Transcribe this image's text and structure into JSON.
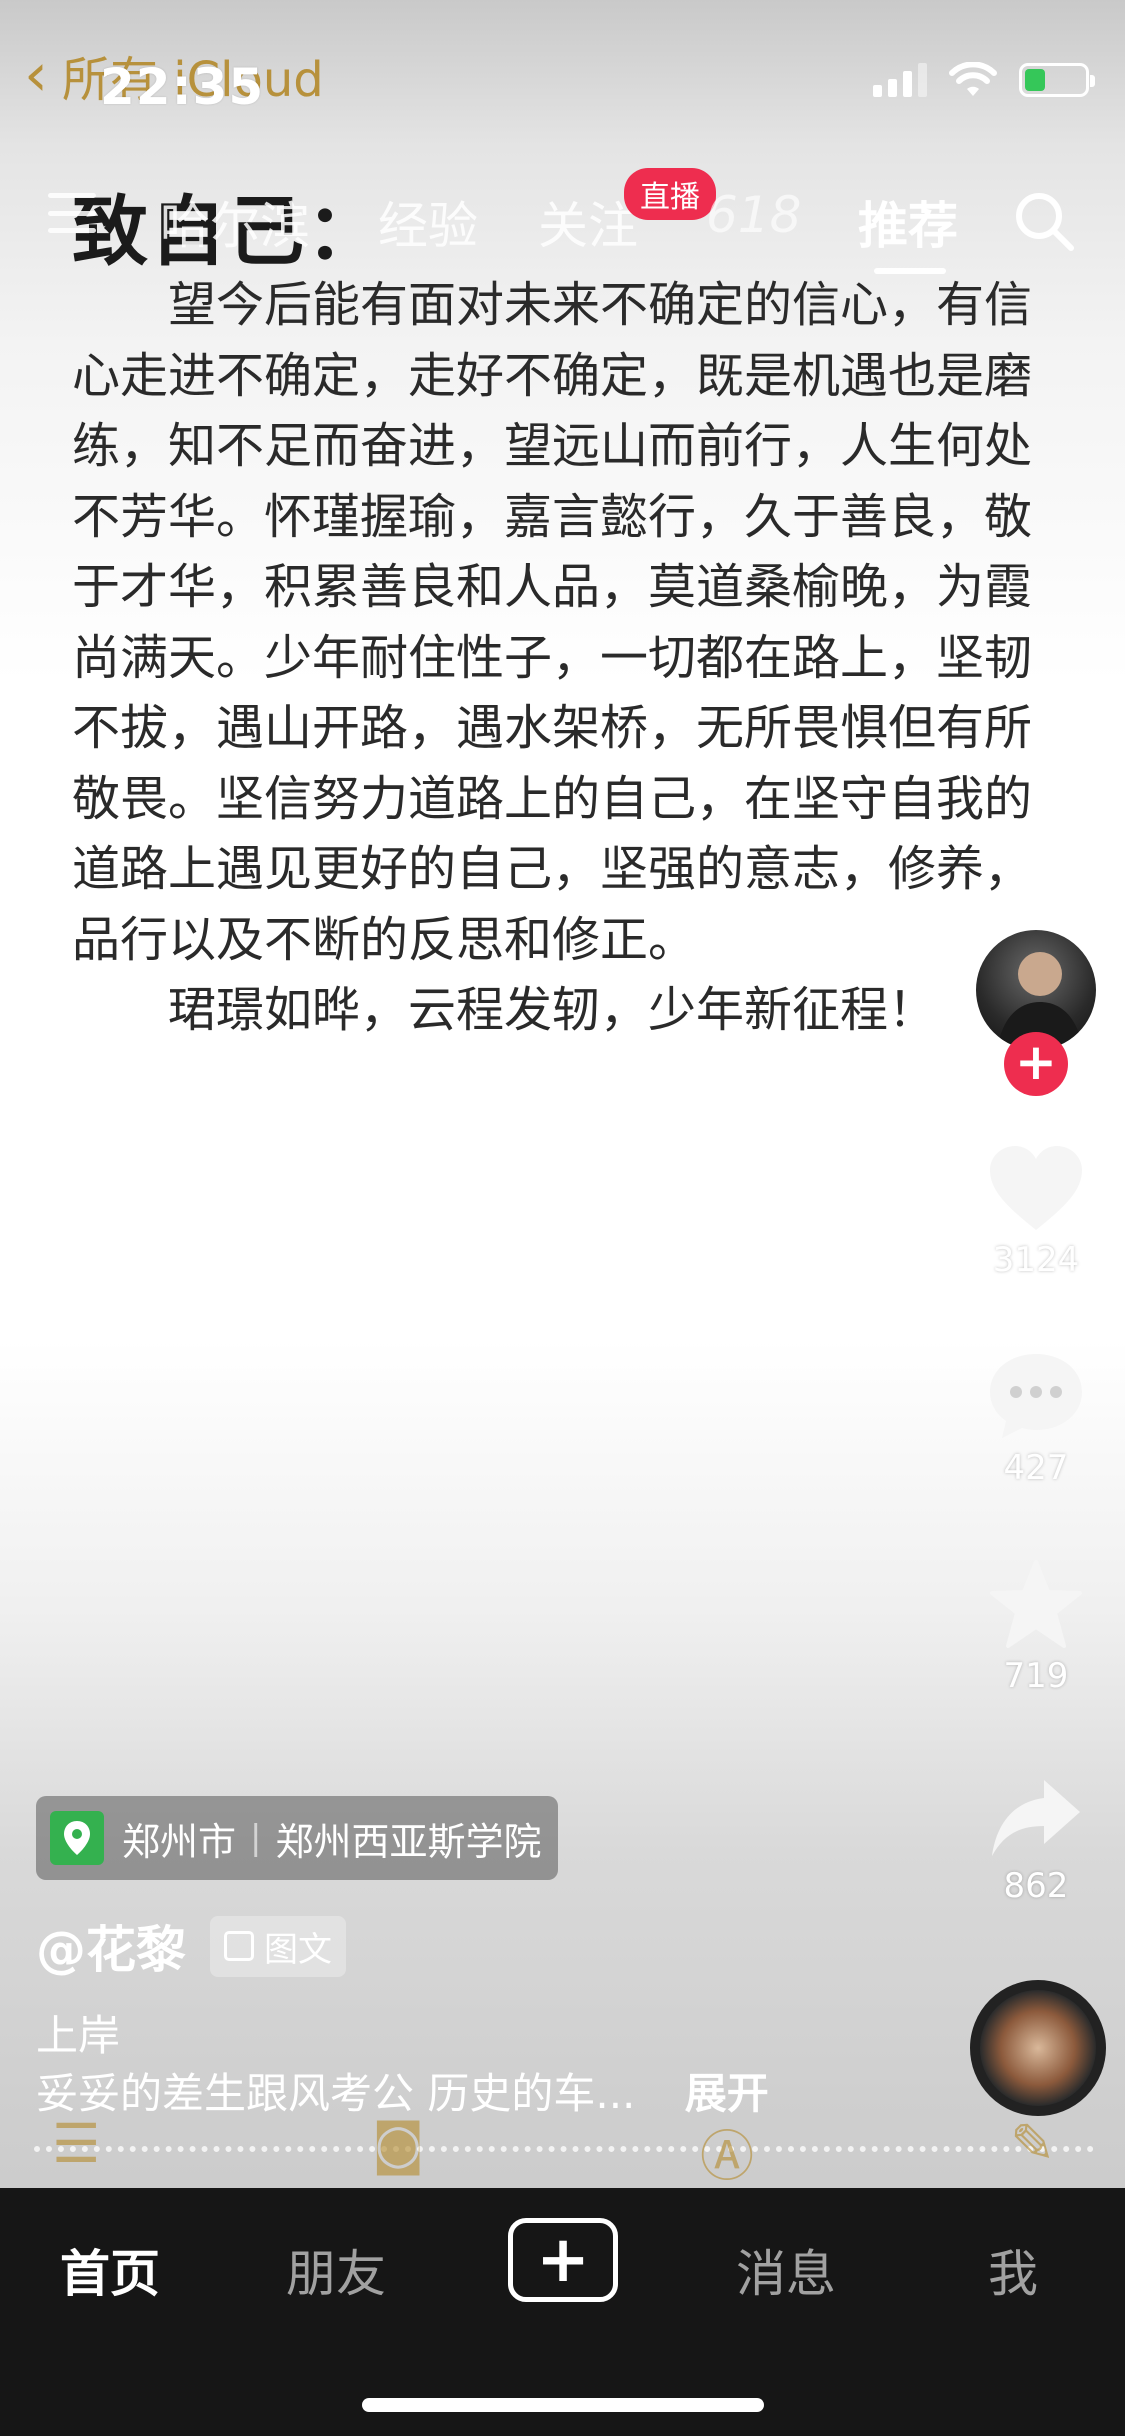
{
  "status_bar": {
    "time": "22:35",
    "back_app": "所有 iCloud"
  },
  "top_nav": {
    "tabs": [
      {
        "label": "哈尔滨"
      },
      {
        "label": "经验"
      },
      {
        "label": "关注"
      },
      {
        "label": "618"
      },
      {
        "label": "推荐"
      }
    ],
    "active_tab": "推荐",
    "live_badge": "直播"
  },
  "note": {
    "title": "致自己：",
    "paragraph1": "望今后能有面对未来不确定的信心，有信心走进不确定，走好不确定，既是机遇也是磨练，知不足而奋进，望远山而前行，人生何处不芳华。怀瑾握瑜，嘉言懿行，久于善良，敬于才华，积累善良和人品，莫道桑榆晚，为霞尚满天。少年耐住性子，一切都在路上，坚韧不拔，遇山开路，遇水架桥，无所畏惧但有所敬畏。坚信努力道路上的自己，在坚守自我的道路上遇见更好的自己，坚强的意志，修养，品行以及不断的反思和修正。",
    "paragraph2": "珺璟如晔，云程发轫，少年新征程！"
  },
  "actions": {
    "like_count": "3124",
    "comment_count": "427",
    "favorite_count": "719",
    "share_count": "862"
  },
  "post": {
    "location_city": "郑州市",
    "location_place": "郑州西亚斯学院",
    "author": "@花黎",
    "type_label": "图文",
    "desc_line1": "上岸",
    "desc_line2": "妥妥的差生跟风考公 历史的车...",
    "expand_label": "展开"
  },
  "bottom_nav": {
    "home": "首页",
    "friends": "朋友",
    "messages": "消息",
    "me": "我"
  },
  "colors": {
    "accent_red": "#ee2d4f",
    "notes_gold": "#b48a2c",
    "location_green": "#34b14f",
    "nav_bg": "#161616"
  }
}
